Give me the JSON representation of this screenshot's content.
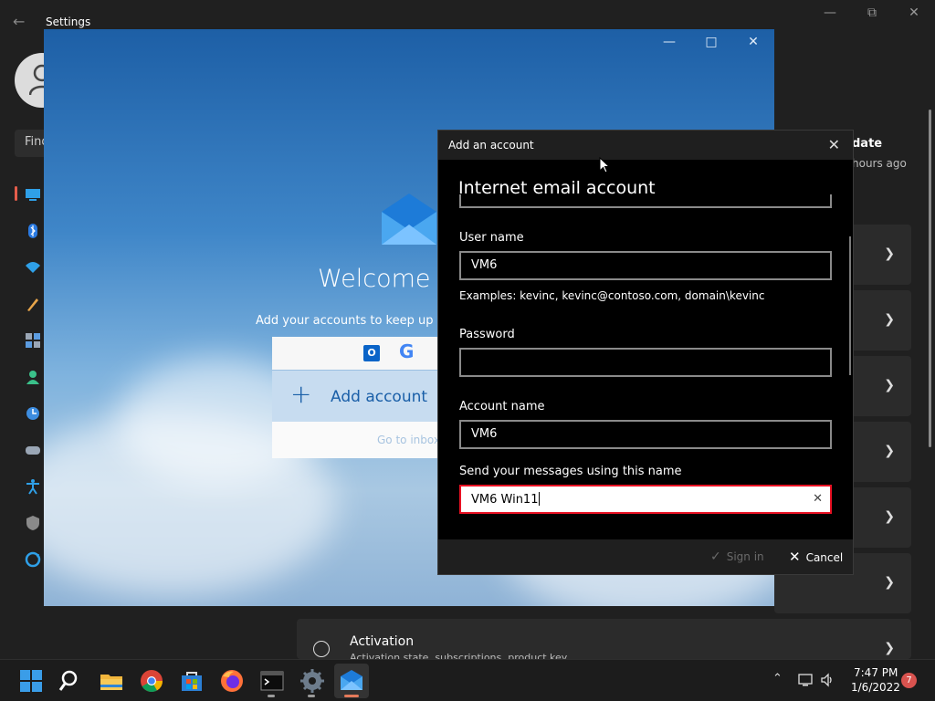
{
  "settings": {
    "title": "Settings",
    "search_placeholder": "Find a setting",
    "update_header": "date",
    "update_sub": "hours ago",
    "activation_title": "Activation",
    "activation_sub": "Activation state, subscriptions, product key"
  },
  "mail": {
    "welcome": "Welcome to Mail",
    "subtitle": "Add your accounts to keep up to date",
    "add_account": "Add account",
    "goto_inbox": "Go to inbox",
    "provider_google": "G",
    "provider_outlook": "O"
  },
  "dialog": {
    "title": "Add an account",
    "heading": "Internet email account",
    "username_label": "User name",
    "username_value": "VM6",
    "example": "Examples: kevinc, kevinc@contoso.com, domain\\kevinc",
    "password_label": "Password",
    "password_value": "",
    "account_name_label": "Account name",
    "account_name_value": "VM6",
    "send_name_label": "Send your messages using this name",
    "send_name_value": "VM6 Win11",
    "signin_label": "Sign in",
    "cancel_label": "Cancel"
  },
  "taskbar": {
    "time": "7:47 PM",
    "date": "1/6/2022",
    "notifications": "7"
  },
  "colors": {
    "accent": "#e81123",
    "mail_blue": "#1a5fa8",
    "background": "#202020"
  }
}
